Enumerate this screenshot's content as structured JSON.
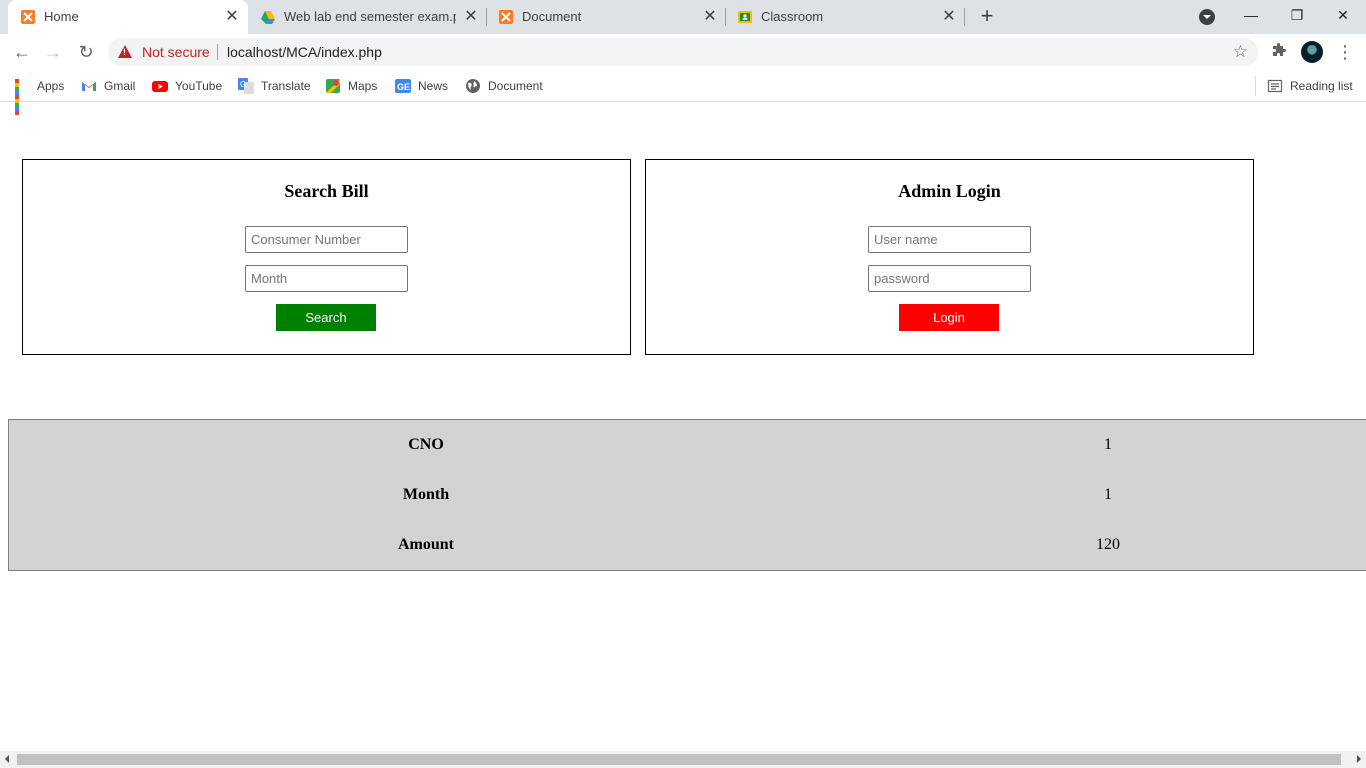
{
  "browser": {
    "tabs": [
      {
        "title": "Home",
        "favicon": "xampp-icon",
        "active": true
      },
      {
        "title": "Web lab end semester exam.pdf",
        "favicon": "google-drive-icon",
        "active": false
      },
      {
        "title": "Document",
        "favicon": "xampp-icon",
        "active": false
      },
      {
        "title": "Classroom",
        "favicon": "google-classroom-icon",
        "active": false
      }
    ],
    "new_tab": "+",
    "window_controls": {
      "minimize": "—",
      "restore": "❐",
      "close": "✕"
    },
    "nav": {
      "back": "←",
      "forward": "→",
      "reload": "↻"
    },
    "security_label": "Not secure",
    "url": "localhost/MCA/index.php",
    "bookmarks": [
      {
        "label": "Apps",
        "icon": "apps-grid-icon"
      },
      {
        "label": "Gmail",
        "icon": "gmail-icon"
      },
      {
        "label": "YouTube",
        "icon": "youtube-icon"
      },
      {
        "label": "Translate",
        "icon": "translate-icon"
      },
      {
        "label": "Maps",
        "icon": "maps-icon"
      },
      {
        "label": "News",
        "icon": "news-icon"
      },
      {
        "label": "Document",
        "icon": "globe-icon"
      }
    ],
    "reading_list": "Reading list"
  },
  "search_bill": {
    "heading": "Search Bill",
    "consumer_placeholder": "Consumer Number",
    "month_placeholder": "Month",
    "button_label": "Search",
    "button_color": "#008000"
  },
  "admin_login": {
    "heading": "Admin Login",
    "username_placeholder": "User name",
    "password_placeholder": "password",
    "button_label": "Login",
    "button_color": "#ff0000"
  },
  "result": {
    "rows": [
      {
        "label": "CNO",
        "value": "1"
      },
      {
        "label": "Month",
        "value": "1"
      },
      {
        "label": "Amount",
        "value": "120"
      }
    ]
  }
}
